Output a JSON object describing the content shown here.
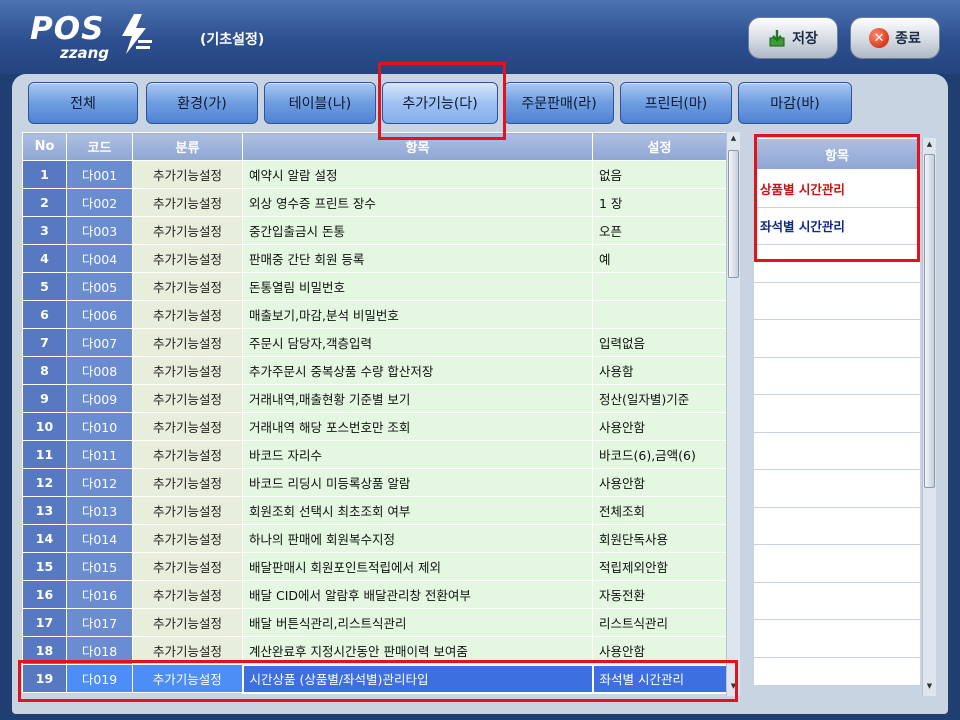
{
  "header": {
    "logo_main": "POS",
    "logo_sub": "zzang",
    "screen_title": "(기초설정)",
    "save_label": "저장",
    "close_label": "종료"
  },
  "tabs": [
    {
      "label": "전체"
    },
    {
      "label": "환경(가)"
    },
    {
      "label": "테이블(나)"
    },
    {
      "label": "추가기능(다)"
    },
    {
      "label": "주문판매(라)"
    },
    {
      "label": "프린터(마)"
    },
    {
      "label": "마감(바)"
    }
  ],
  "table": {
    "columns": [
      "No",
      "코드",
      "분류",
      "항목",
      "설정"
    ],
    "rows": [
      {
        "no": "1",
        "code": "다001",
        "cat": "추가기능설정",
        "item": "예약시 알람 설정",
        "val": "없음"
      },
      {
        "no": "2",
        "code": "다002",
        "cat": "추가기능설정",
        "item": "외상 영수증 프린트 장수",
        "val": "1 장"
      },
      {
        "no": "3",
        "code": "다003",
        "cat": "추가기능설정",
        "item": "중간입출금시 돈통",
        "val": "오픈"
      },
      {
        "no": "4",
        "code": "다004",
        "cat": "추가기능설정",
        "item": "판매중 간단 회원 등록",
        "val": "예"
      },
      {
        "no": "5",
        "code": "다005",
        "cat": "추가기능설정",
        "item": "돈통열림 비밀번호",
        "val": ""
      },
      {
        "no": "6",
        "code": "다006",
        "cat": "추가기능설정",
        "item": "매출보기,마감,분석 비밀번호",
        "val": ""
      },
      {
        "no": "7",
        "code": "다007",
        "cat": "추가기능설정",
        "item": "주문시 담당자,객층입력",
        "val": "입력없음"
      },
      {
        "no": "8",
        "code": "다008",
        "cat": "추가기능설정",
        "item": "추가주문시 중복상품 수량 합산저장",
        "val": "사용함"
      },
      {
        "no": "9",
        "code": "다009",
        "cat": "추가기능설정",
        "item": "거래내역,매출현황 기준별 보기",
        "val": "정산(일자별)기준"
      },
      {
        "no": "10",
        "code": "다010",
        "cat": "추가기능설정",
        "item": "거래내역 해당 포스번호만 조회",
        "val": "사용안함"
      },
      {
        "no": "11",
        "code": "다011",
        "cat": "추가기능설정",
        "item": "바코드 자리수",
        "val": "바코드(6),금액(6)"
      },
      {
        "no": "12",
        "code": "다012",
        "cat": "추가기능설정",
        "item": "바코드 리딩시 미등록상품 알람",
        "val": "사용안함"
      },
      {
        "no": "13",
        "code": "다013",
        "cat": "추가기능설정",
        "item": "회원조회 선택시 최초조회 여부",
        "val": "전체조회"
      },
      {
        "no": "14",
        "code": "다014",
        "cat": "추가기능설정",
        "item": "하나의 판매에 회원복수지정",
        "val": "회원단독사용"
      },
      {
        "no": "15",
        "code": "다015",
        "cat": "추가기능설정",
        "item": "배달판매시 회원포인트적립에서 제외",
        "val": "적립제외안함"
      },
      {
        "no": "16",
        "code": "다016",
        "cat": "추가기능설정",
        "item": "배달 CID에서 알람후 배달관리창 전환여부",
        "val": "자동전환"
      },
      {
        "no": "17",
        "code": "다017",
        "cat": "추가기능설정",
        "item": "배달 버튼식관리,리스트식관리",
        "val": "리스트식관리"
      },
      {
        "no": "18",
        "code": "다018",
        "cat": "추가기능설정",
        "item": "계산완료후 지정시간동안 판매이력 보여줌",
        "val": "사용안함"
      },
      {
        "no": "19",
        "code": "다019",
        "cat": "추가기능설정",
        "item": "시간상품 (상품별/좌석별)관리타입",
        "val": "좌석별 시간관리"
      }
    ]
  },
  "options": {
    "header": "항목",
    "items": [
      {
        "label": "상품별 시간관리"
      },
      {
        "label": "좌석별 시간관리"
      }
    ]
  },
  "colors": {
    "highlight_box": "#e3121b",
    "tab_blue": "#6f9de0",
    "row_green": "#e3f7e1",
    "selected_blue": "#3d6fe0"
  }
}
